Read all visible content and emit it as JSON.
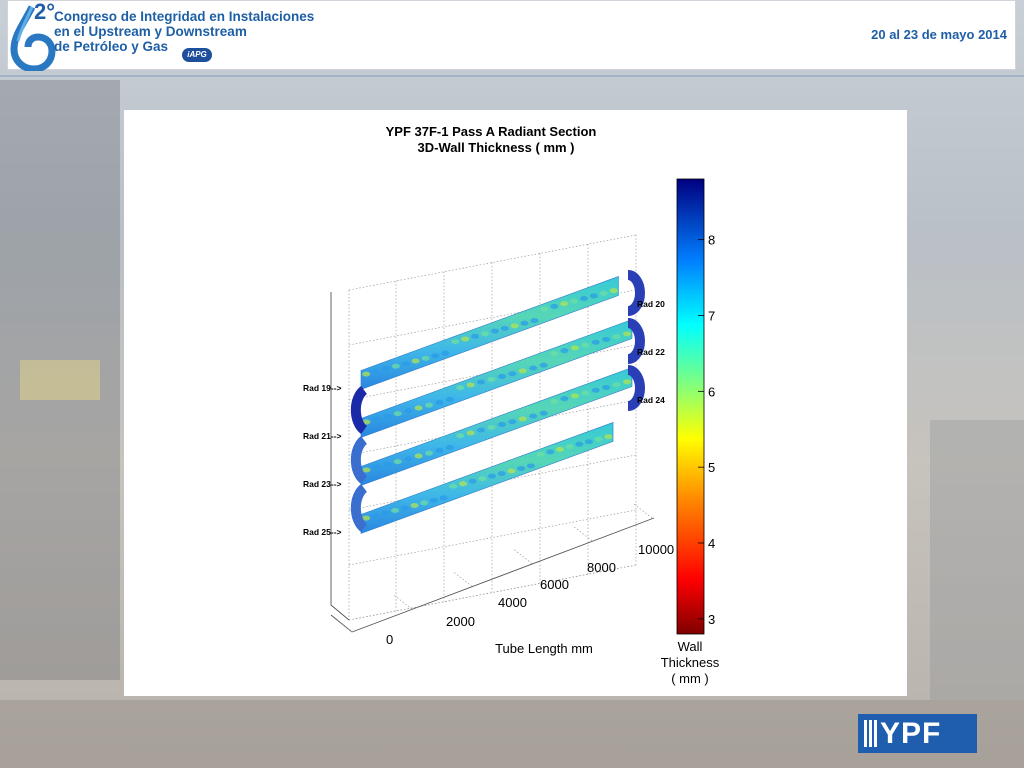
{
  "header": {
    "logo_number": "2°",
    "title_lines": [
      "Congreso de Integridad en Instalaciones",
      "en el Upstream y Downstream",
      "de Petróleo y Gas"
    ],
    "org_badge": "iAPG",
    "date": "20 al 23 de mayo 2014"
  },
  "footer": {
    "logo_text": "YPF"
  },
  "colors": {
    "brand_blue": "#1e5fa6",
    "ypf_blue": "#1f5dae"
  },
  "chart_data": {
    "type": "3d-surface",
    "title": "YPF 37F-1 Pass A Radiant Section",
    "subtitle": "3D-Wall Thickness ( mm )",
    "xlabel": "Tube Length mm",
    "x_ticks": [
      0,
      2000,
      4000,
      6000,
      8000,
      10000
    ],
    "tube_labels_left": [
      "Rad 19-->",
      "Rad 21-->",
      "Rad 23-->",
      "Rad 25-->"
    ],
    "tube_labels_right": [
      "Rad 20",
      "Rad 22",
      "Rad 24"
    ],
    "colorbar": {
      "label_lines": [
        "Wall",
        "Thickness",
        "( mm )"
      ],
      "ticks": [
        3,
        4,
        5,
        6,
        7,
        8
      ],
      "range": [
        2.8,
        8.8
      ],
      "colormap": "jet"
    },
    "grid": true
  }
}
